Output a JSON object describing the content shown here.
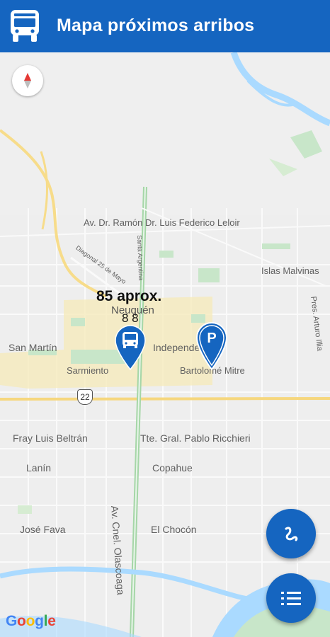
{
  "app_bar": {
    "title": "Mapa próximos arribos",
    "icon": "bus-icon",
    "color": "#1565c0"
  },
  "map": {
    "compass": "compass-icon",
    "streets": {
      "av_dr_ramon": "Av. Dr. Ramón",
      "dr_luis_leloir": "Dr. Luis Federico Leloir",
      "islas_malvinas": "Islas Malvinas",
      "san_martin": "San Martín",
      "independencia": "Independencia",
      "sarmiento": "Sarmiento",
      "bartolome_mitre": "Bartolomé Mitre",
      "fray_luis_beltran": "Fray Luis Beltrán",
      "tte_gral_ricchieri": "Tte. Gral. Pablo Ricchieri",
      "lanin": "Lanín",
      "copahue": "Copahue",
      "jose_fava": "José Fava",
      "el_chocon": "El Chocón",
      "av_olascoaga": "Av. Cnel. Olascoaga",
      "pres_arturo_illia": "Pres. Arturo Illia",
      "santa_argentina": "Santa Argentina",
      "diagonal": "Diagonal 25 de Mayo",
      "route": "22"
    },
    "city": "Neuquén",
    "bus_marker": {
      "arrival": "85 aprox.",
      "line": "8 8"
    },
    "stop_marker": {
      "letter": "P"
    },
    "google_logo": [
      "G",
      "o",
      "o",
      "g",
      "l",
      "e"
    ]
  },
  "fabs": {
    "route_button": "route-icon",
    "list_button": "list-icon"
  },
  "colors": {
    "primary": "#1565c0",
    "water": "#aadaff",
    "park": "#c8e6c9",
    "highway": "#fff3c4"
  }
}
